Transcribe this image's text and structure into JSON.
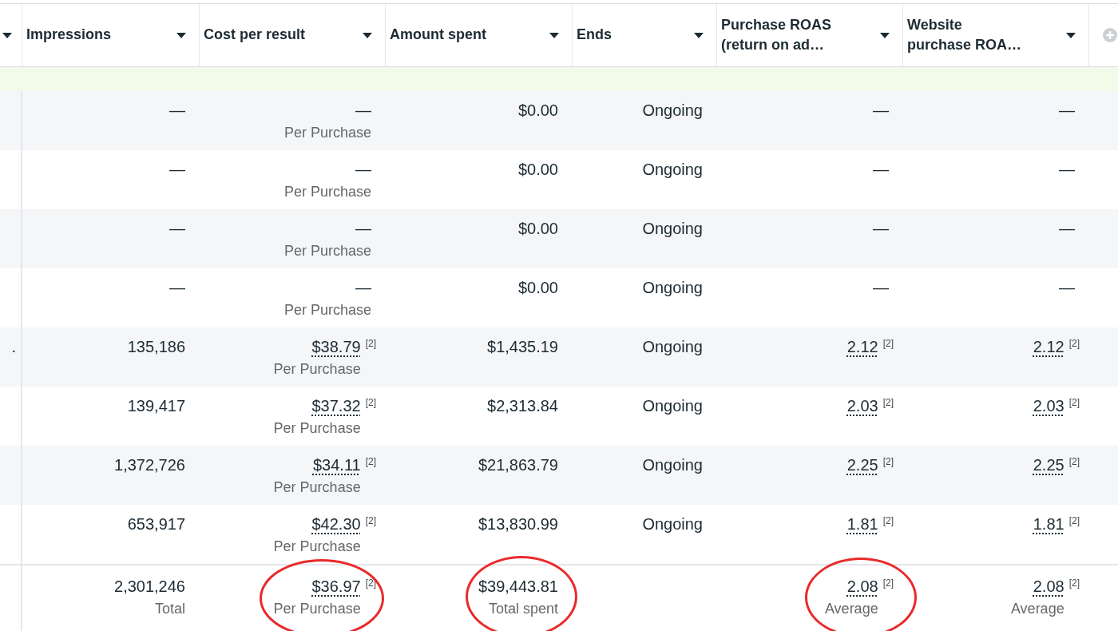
{
  "columns": [
    {},
    {
      "label": "Impressions"
    },
    {
      "label": "Cost per result"
    },
    {
      "label": "Amount spent"
    },
    {
      "label": "Ends"
    },
    {
      "label": "Purchase ROAS (return on ad…"
    },
    {
      "label": "Website purchase ROA…"
    }
  ],
  "rows": [
    {
      "impressions": "—",
      "cost": {
        "value": "—",
        "label": "Per Purchase"
      },
      "amount": "$0.00",
      "ends": "Ongoing",
      "roas": {
        "value": "—"
      },
      "website_roas": {
        "value": "—"
      }
    },
    {
      "impressions": "—",
      "cost": {
        "value": "—",
        "label": "Per Purchase"
      },
      "amount": "$0.00",
      "ends": "Ongoing",
      "roas": {
        "value": "—"
      },
      "website_roas": {
        "value": "—"
      }
    },
    {
      "impressions": "—",
      "cost": {
        "value": "—",
        "label": "Per Purchase"
      },
      "amount": "$0.00",
      "ends": "Ongoing",
      "roas": {
        "value": "—"
      },
      "website_roas": {
        "value": "—"
      }
    },
    {
      "impressions": "—",
      "cost": {
        "value": "—",
        "label": "Per Purchase"
      },
      "amount": "$0.00",
      "ends": "Ongoing",
      "roas": {
        "value": "—"
      },
      "website_roas": {
        "value": "—"
      }
    },
    {
      "column_1": ".",
      "impressions": "135,186",
      "cost": {
        "value": "$38.79",
        "footnote": "[2]",
        "label": "Per Purchase"
      },
      "amount": "$1,435.19",
      "ends": "Ongoing",
      "roas": {
        "value": "2.12",
        "footnote": "[2]"
      },
      "website_roas": {
        "value": "2.12",
        "footnote": "[2]"
      }
    },
    {
      "impressions": "139,417",
      "cost": {
        "value": "$37.32",
        "footnote": "[2]",
        "label": "Per Purchase"
      },
      "amount": "$2,313.84",
      "ends": "Ongoing",
      "roas": {
        "value": "2.03",
        "footnote": "[2]"
      },
      "website_roas": {
        "value": "2.03",
        "footnote": "[2]"
      }
    },
    {
      "impressions": "1,372,726",
      "cost": {
        "value": "$34.11",
        "footnote": "[2]",
        "label": "Per Purchase"
      },
      "amount": "$21,863.79",
      "ends": "Ongoing",
      "roas": {
        "value": "2.25",
        "footnote": "[2]"
      },
      "website_roas": {
        "value": "2.25",
        "footnote": "[2]"
      }
    },
    {
      "impressions": "653,917",
      "cost": {
        "value": "$42.30",
        "footnote": "[2]",
        "label": "Per Purchase"
      },
      "amount": "$13,830.99",
      "ends": "Ongoing",
      "roas": {
        "value": "1.81",
        "footnote": "[2]"
      },
      "website_roas": {
        "value": "1.81",
        "footnote": "[2]"
      }
    }
  ],
  "totals": {
    "impressions": {
      "value": "2,301,246",
      "label": "Total"
    },
    "cost": {
      "value": "$36.97",
      "footnote": "[2]",
      "label": "Per Purchase",
      "circled": true
    },
    "amount": {
      "value": "$39,443.81",
      "label": "Total spent",
      "circled": true
    },
    "roas": {
      "value": "2.08",
      "footnote": "[2]",
      "label": "Average",
      "circled": true
    },
    "website_roas": {
      "value": "2.08",
      "footnote": "[2]",
      "label": "Average"
    }
  }
}
